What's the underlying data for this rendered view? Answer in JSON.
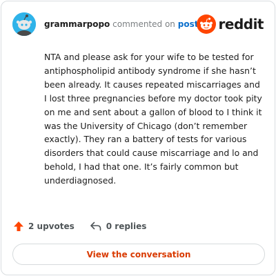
{
  "header": {
    "username": "grammarpopo",
    "action_text": "commented on",
    "post_link": "post",
    "brand": "reddit"
  },
  "comment": {
    "body": "NTA and please ask for your wife to be tested for antiphospholipid antibody syndrome if she hasn’t been already. It causes repeated miscarriages and I lost three pregnancies before my doctor took pity on me and sent about a gallon of blood to I think it was the University of Chicago (don’t remember exactly). They ran a battery of tests for various disorders that could cause miscarriage and lo and behold, I had that one. It’s fairly common but underdiagnosed."
  },
  "actions": {
    "upvotes": "2 upvotes",
    "replies": "0 replies"
  },
  "button": {
    "label": "View the conversation"
  },
  "colors": {
    "brand_orange": "#ff4500",
    "link_blue": "#0a6fcc",
    "avatar_blue": "#2fb3e9",
    "button_text": "#d93a00"
  },
  "icons": [
    "avatar-snoo-icon",
    "reddit-logo-icon",
    "upvote-arrow-icon",
    "reply-arrow-icon"
  ]
}
